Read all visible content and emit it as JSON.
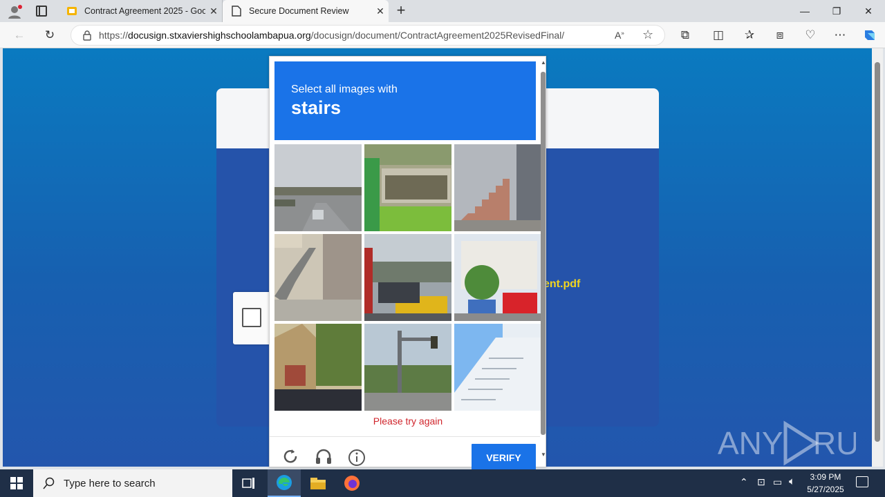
{
  "browser": {
    "tabs": [
      {
        "title": "Contract Agreement 2025 - Goog",
        "active": false
      },
      {
        "title": "Secure Document Review",
        "active": true
      }
    ],
    "url_prefix": "https://",
    "url_domain": "docusign.stxaviershighschoolambapua.org",
    "url_path": "/docusign/document/ContractAgreement2025RevisedFinal/"
  },
  "page": {
    "filename_fragment": "ent.pdf"
  },
  "captcha": {
    "instruction": "Select all images with",
    "target": "stairs",
    "error": "Please try again",
    "verify_label": "VERIFY",
    "tiles": [
      "road-overpass",
      "bus-shelter",
      "brick-steps",
      "concrete-stairs",
      "harbor-street",
      "city-building",
      "house-stairs",
      "traffic-light",
      "white-stairs"
    ]
  },
  "watermark": "ANY RUN",
  "taskbar": {
    "search_placeholder": "Type here to search",
    "time": "3:09 PM",
    "date": "5/27/2025"
  },
  "colors": {
    "captcha_blue": "#1a73e8",
    "error_red": "#d0252c",
    "filename_yellow": "#f2d51e"
  }
}
